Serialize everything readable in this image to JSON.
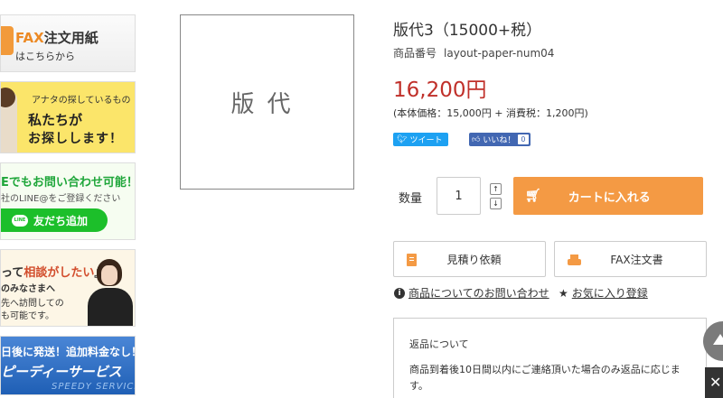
{
  "sidebar": {
    "fax_banner": {
      "prefix": "FAX",
      "title": "注文用紙",
      "subtitle": "はこちらから"
    },
    "search_banner": {
      "line1": "アナタの探しているもの",
      "line2": "私たちが",
      "line3": "お探しします！"
    },
    "line_banner": {
      "line1": "Eでもお問い合わせ可能！",
      "line2": "社のLINE@をご登録ください",
      "button_icon": "LINE",
      "button_label": "友だち追加"
    },
    "consult_banner": {
      "line1_pre": "って",
      "line1_accent": "相談がしたい",
      "line1_post": "』",
      "line2": "のみなさまへ",
      "line3": "先へ訪問しての",
      "line4": "も可能です。"
    },
    "speedy_banner": {
      "line1": "日後に発送！追加料金なし！",
      "line2": "ピーディーサービス",
      "line3": "SPEEDY SERVICE"
    }
  },
  "product": {
    "image_text": "版代",
    "title": "版代3（15000+税）",
    "code_label": "商品番号",
    "code_value": "layout-paper-num04",
    "price": "16,200円",
    "price_detail": "(本体価格：15,000円 + 消費税：1,200円)"
  },
  "social": {
    "tweet_label": "ツイート",
    "like_label": "いいね！",
    "like_count": "0"
  },
  "purchase": {
    "qty_label": "数量",
    "qty_value": "1",
    "step_up": "↑",
    "step_down": "↓",
    "cart_label": "カートに入れる"
  },
  "actions": {
    "quote_label": "見積り依頼",
    "fax_label": "FAX注文書",
    "inquiry_label": "商品についてのお問い合わせ",
    "favorite_label": "お気に入り登録"
  },
  "returns": {
    "title": "返品について",
    "body": "商品到着後10日間以内にご連絡頂いた場合のみ返品に応じます。"
  },
  "colors": {
    "accent_orange": "#f49a44",
    "price_red": "#c0302a",
    "twitter_blue": "#1da1f2",
    "facebook_blue": "#4267b2",
    "line_green": "#1cbf2a"
  }
}
